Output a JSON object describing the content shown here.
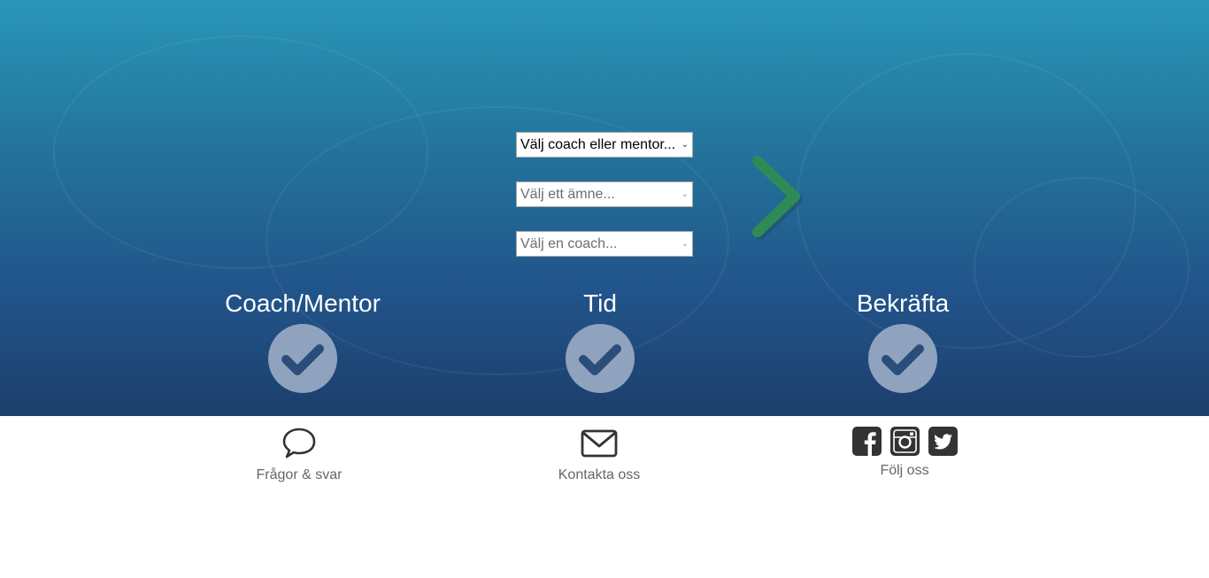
{
  "selects": {
    "coach_type": {
      "value": "Välj coach eller mentor..."
    },
    "subject": {
      "value": "Välj ett ämne..."
    },
    "coach": {
      "value": "Välj en coach..."
    }
  },
  "next_button": {
    "icon": "chevron-right-icon",
    "color": "#2e8b57"
  },
  "steps": [
    {
      "title": "Coach/Mentor",
      "icon": "checkmark-icon"
    },
    {
      "title": "Tid",
      "icon": "checkmark-icon"
    },
    {
      "title": "Bekräfta",
      "icon": "checkmark-icon"
    }
  ],
  "footer": {
    "faq": {
      "label": "Frågor & svar",
      "icon": "speech-bubble-icon"
    },
    "contact": {
      "label": "Kontakta oss",
      "icon": "envelope-icon"
    },
    "follow": {
      "label": "Följ oss",
      "icons": [
        "facebook-icon",
        "instagram-icon",
        "twitter-icon"
      ]
    }
  },
  "colors": {
    "hero_top": "#2996b9",
    "hero_bottom": "#1d3f6c",
    "check_circle": "#8fa3bf",
    "check_mark": "#2a4d7a",
    "footer_text": "#666666"
  }
}
